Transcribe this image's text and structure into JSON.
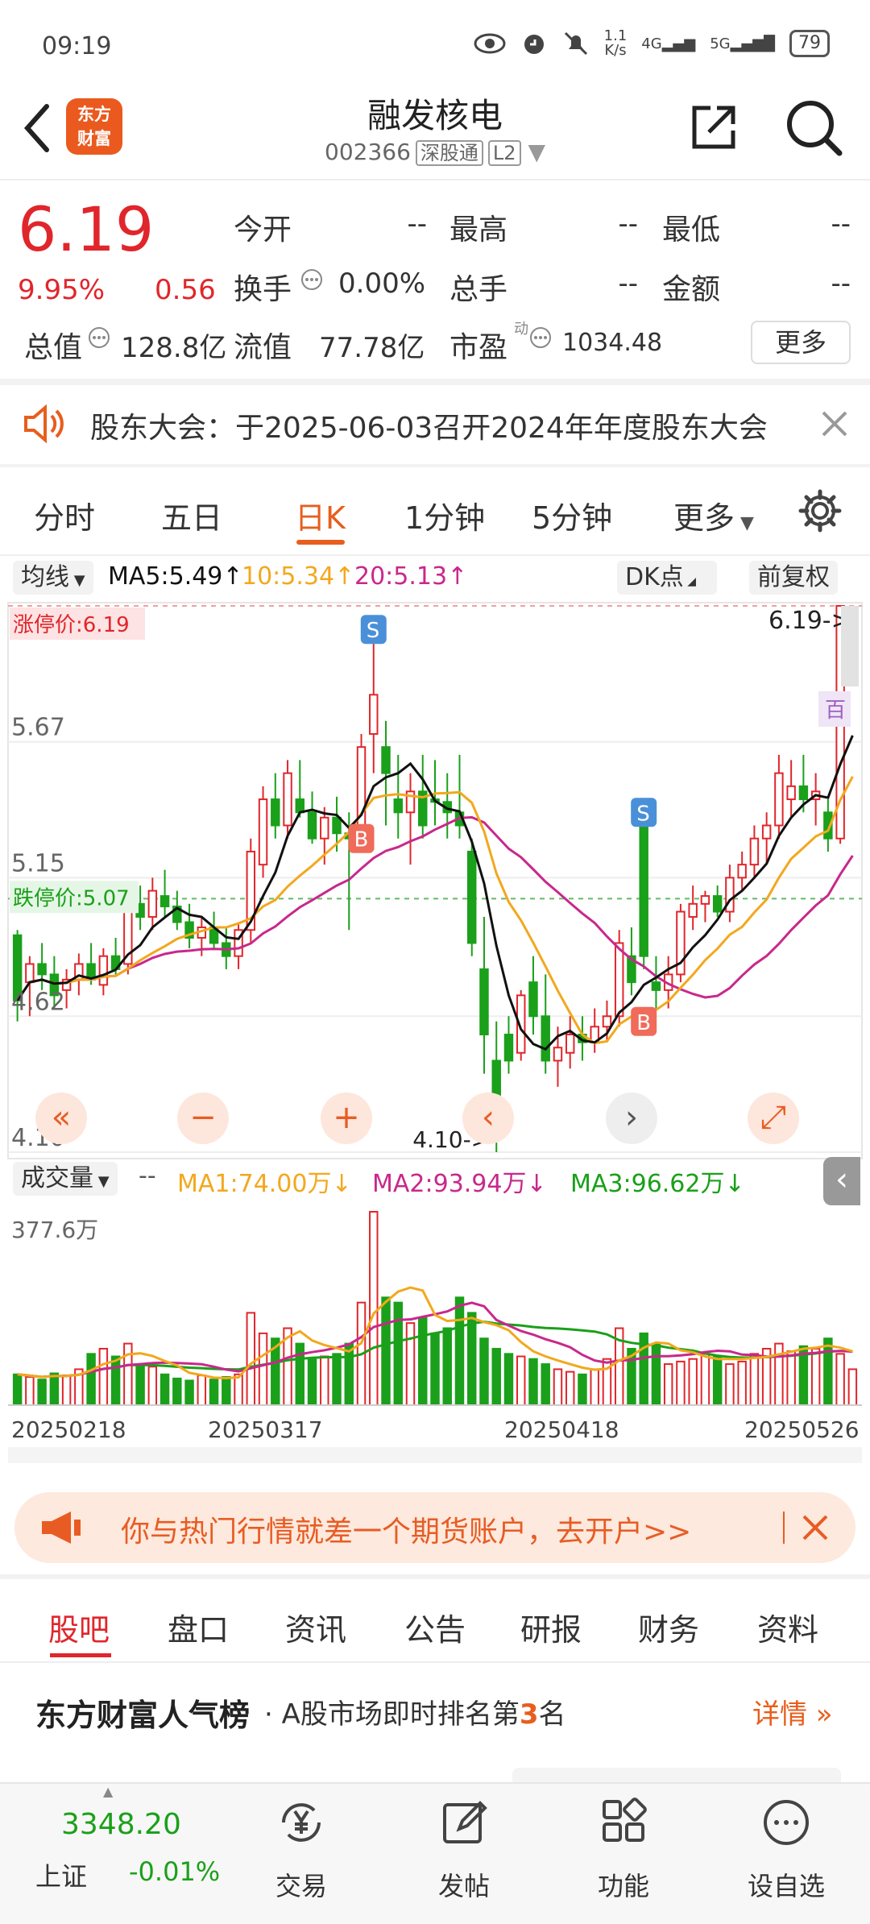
{
  "status_bar": {
    "time": "09:19",
    "net_speed_top": "1.1",
    "net_speed_bottom": "K/s",
    "signal1": "4G",
    "signal2": "5G",
    "battery": "79"
  },
  "header": {
    "stock_name": "融发核电",
    "stock_code": "002366",
    "market_tag": "深股通",
    "level_tag": "L2",
    "logo_line1": "东方",
    "logo_line2": "财富"
  },
  "quote": {
    "price": "6.19",
    "change_pct": "9.95%",
    "change_amt": "0.56",
    "open_label": "今开",
    "open_value": "--",
    "high_label": "最高",
    "high_value": "--",
    "low_label": "最低",
    "low_value": "--",
    "turnover_label": "换手",
    "turnover_value": "0.00%",
    "volume_label": "总手",
    "volume_value": "--",
    "amount_label": "金额",
    "amount_value": "--",
    "mktcap_label": "总值",
    "mktcap_value": "128.8亿",
    "float_label": "流值",
    "float_value": "77.78亿",
    "pe_label": "市盈",
    "pe_sup": "动",
    "pe_value": "1034.48",
    "more_label": "更多"
  },
  "notice": {
    "text": "股东大会：于2025-06-03召开2024年年度股东大会"
  },
  "chart_tabs": [
    "分时",
    "五日",
    "日K",
    "1分钟",
    "5分钟",
    "更多"
  ],
  "active_chart_tab": "日K",
  "ma_bar": {
    "selector": "均线",
    "ma5": "MA5:5.49",
    "ma10": "10:5.34",
    "ma20": "20:5.13",
    "dk": "DK点",
    "adjust": "前复权"
  },
  "colors": {
    "up": "#e0262b",
    "down": "#1aa01a",
    "ma5": "#111111",
    "ma10": "#f2a81d",
    "ma20": "#c8288c",
    "accent": "#e75e1d"
  },
  "chart_labels": {
    "limit_up": "涨停价:6.19",
    "limit_down": "跌停价:5.07",
    "y_top": "5.67",
    "y_mid": "5.15",
    "y_low": "4.62",
    "y_bottom": "4.10",
    "last_arrow": "6.19->",
    "low_arrow": "4.10->",
    "bai": "百",
    "sell_marker": "S",
    "buy_marker": "B"
  },
  "volume": {
    "selector": "成交量",
    "dash": "--",
    "ma1": "MA1:74.00万",
    "ma2": "MA2:93.94万",
    "ma3": "MA3:96.62万",
    "ymax": "377.6万"
  },
  "x_dates": [
    "20250218",
    "20250317",
    "20250418",
    "20250526"
  ],
  "chart_data": {
    "type": "candlestick",
    "ylim": [
      4.1,
      6.19
    ],
    "y_ticks": [
      5.67,
      5.15,
      4.62,
      4.1
    ],
    "x_ticks": [
      "20250218",
      "20250317",
      "20250418",
      "20250526"
    ],
    "candles": [
      [
        4.93,
        4.95,
        4.6,
        4.68
      ],
      [
        4.75,
        4.85,
        4.62,
        4.82
      ],
      [
        4.82,
        4.9,
        4.72,
        4.78
      ],
      [
        4.78,
        4.85,
        4.65,
        4.7
      ],
      [
        4.72,
        4.8,
        4.65,
        4.76
      ],
      [
        4.76,
        4.86,
        4.7,
        4.82
      ],
      [
        4.82,
        4.9,
        4.74,
        4.76
      ],
      [
        4.74,
        4.88,
        4.7,
        4.85
      ],
      [
        4.85,
        4.92,
        4.78,
        4.8
      ],
      [
        4.82,
        5.1,
        4.78,
        5.05
      ],
      [
        5.05,
        5.12,
        4.95,
        5.0
      ],
      [
        5.0,
        5.15,
        4.95,
        5.1
      ],
      [
        5.08,
        5.18,
        5.0,
        5.04
      ],
      [
        5.04,
        5.1,
        4.95,
        4.98
      ],
      [
        4.98,
        5.05,
        4.88,
        4.92
      ],
      [
        4.92,
        5.0,
        4.85,
        4.96
      ],
      [
        4.96,
        5.02,
        4.88,
        4.9
      ],
      [
        4.9,
        4.96,
        4.8,
        4.85
      ],
      [
        4.85,
        4.98,
        4.8,
        4.95
      ],
      [
        4.95,
        5.3,
        4.9,
        5.25
      ],
      [
        5.2,
        5.5,
        5.15,
        5.45
      ],
      [
        5.45,
        5.55,
        5.3,
        5.35
      ],
      [
        5.35,
        5.6,
        5.3,
        5.55
      ],
      [
        5.45,
        5.6,
        5.38,
        5.4
      ],
      [
        5.4,
        5.48,
        5.28,
        5.3
      ],
      [
        5.3,
        5.42,
        5.2,
        5.38
      ],
      [
        5.38,
        5.46,
        5.25,
        5.32
      ],
      [
        5.32,
        5.4,
        4.95,
        5.3
      ],
      [
        5.3,
        5.7,
        5.25,
        5.65
      ],
      [
        5.7,
        6.05,
        5.55,
        5.85
      ],
      [
        5.65,
        5.75,
        5.35,
        5.55
      ],
      [
        5.45,
        5.62,
        5.3,
        5.4
      ],
      [
        5.4,
        5.55,
        5.2,
        5.48
      ],
      [
        5.48,
        5.62,
        5.3,
        5.35
      ],
      [
        5.45,
        5.6,
        5.35,
        5.44
      ],
      [
        5.44,
        5.55,
        5.3,
        5.4
      ],
      [
        5.4,
        5.62,
        5.3,
        5.35
      ],
      [
        5.25,
        5.3,
        4.85,
        4.9
      ],
      [
        4.8,
        5.0,
        4.4,
        4.55
      ],
      [
        4.45,
        4.6,
        4.1,
        4.25
      ],
      [
        4.55,
        4.62,
        4.4,
        4.45
      ],
      [
        4.48,
        4.72,
        4.45,
        4.7
      ],
      [
        4.75,
        4.85,
        4.55,
        4.62
      ],
      [
        4.62,
        4.78,
        4.4,
        4.45
      ],
      [
        4.45,
        4.58,
        4.35,
        4.5
      ],
      [
        4.48,
        4.62,
        4.42,
        4.55
      ],
      [
        4.55,
        4.62,
        4.45,
        4.52
      ],
      [
        4.52,
        4.65,
        4.48,
        4.58
      ],
      [
        4.58,
        4.68,
        4.52,
        4.62
      ],
      [
        4.62,
        4.95,
        4.58,
        4.9
      ],
      [
        4.85,
        4.96,
        4.7,
        4.75
      ],
      [
        5.35,
        5.4,
        4.8,
        4.85
      ],
      [
        4.75,
        4.85,
        4.65,
        4.72
      ],
      [
        4.72,
        4.85,
        4.65,
        4.78
      ],
      [
        4.78,
        5.05,
        4.75,
        5.02
      ],
      [
        5.0,
        5.12,
        4.95,
        5.05
      ],
      [
        5.05,
        5.1,
        4.98,
        5.08
      ],
      [
        5.08,
        5.12,
        5.0,
        5.02
      ],
      [
        5.02,
        5.2,
        4.98,
        5.15
      ],
      [
        5.15,
        5.25,
        5.1,
        5.2
      ],
      [
        5.2,
        5.35,
        5.15,
        5.3
      ],
      [
        5.3,
        5.4,
        5.2,
        5.35
      ],
      [
        5.35,
        5.62,
        5.3,
        5.55
      ],
      [
        5.45,
        5.6,
        5.38,
        5.5
      ],
      [
        5.5,
        5.62,
        5.4,
        5.45
      ],
      [
        5.45,
        5.55,
        5.35,
        5.48
      ],
      [
        5.4,
        5.45,
        5.25,
        5.3
      ],
      [
        5.3,
        6.19,
        5.28,
        6.19
      ],
      [
        5.95,
        6.15,
        5.9,
        6.05
      ]
    ],
    "volume": [
      60,
      55,
      50,
      62,
      58,
      70,
      100,
      110,
      95,
      120,
      80,
      75,
      60,
      52,
      48,
      58,
      50,
      55,
      60,
      180,
      140,
      130,
      150,
      120,
      90,
      95,
      100,
      120,
      200,
      377,
      210,
      200,
      160,
      170,
      140,
      150,
      210,
      180,
      130,
      110,
      100,
      95,
      90,
      80,
      70,
      65,
      60,
      70,
      90,
      150,
      110,
      140,
      120,
      80,
      85,
      90,
      100,
      95,
      80,
      85,
      100,
      110,
      120,
      105,
      115,
      110,
      130,
      100,
      70
    ]
  },
  "ad": {
    "text": "你与热门行情就差一个期货账户，去开户>>"
  },
  "bottom_tabs": [
    "股吧",
    "盘口",
    "资讯",
    "公告",
    "研报",
    "财务",
    "资料"
  ],
  "active_bottom_tab": "股吧",
  "rank": {
    "title": "东方财富人气榜",
    "sub_prefix": "· A股市场即时排名第",
    "rank_num": "3",
    "sub_suffix": "名",
    "detail": "详情"
  },
  "bottom_nav": {
    "index_value": "3348.20",
    "index_name": "上证",
    "index_change": "-0.01%",
    "trade": "交易",
    "post": "发帖",
    "func": "功能",
    "watch": "设自选"
  }
}
